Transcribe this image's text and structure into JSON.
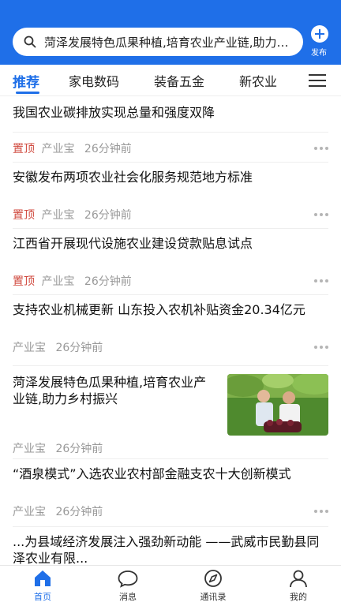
{
  "header": {
    "search_text": "菏泽发展特色瓜果种植,培育农业产业链,助力乡村振兴",
    "publish_label": "发布"
  },
  "tabs": [
    {
      "label": "推荐",
      "active": true
    },
    {
      "label": "家电数码",
      "active": false
    },
    {
      "label": "装备五金",
      "active": false
    },
    {
      "label": "新农业",
      "active": false
    }
  ],
  "feed": [
    {
      "title": "我国农业碳排放实现总量和强度双降",
      "pinned": false,
      "source": "",
      "time": ""
    },
    {
      "title": "安徽发布两项农业社会化服务规范地方标准",
      "pinned": true,
      "pin_label": "置顶",
      "source": "产业宝",
      "time": "26分钟前"
    },
    {
      "title": "江西省开展现代设施农业建设贷款贴息试点",
      "pinned": true,
      "pin_label": "置顶",
      "source": "产业宝",
      "time": "26分钟前"
    },
    {
      "title": "支持农业机械更新 山东投入农机补贴资金20.34亿元",
      "pinned": false,
      "source": "产业宝",
      "time": "26分钟前"
    },
    {
      "title": "菏泽发展特色瓜果种植,培育农业产业链,助力乡村振兴",
      "pinned": false,
      "source": "产业宝",
      "time": "26分钟前"
    },
    {
      "title": "“酒泉模式”入选农业农村部金融支农十大创新模式",
      "pinned": false,
      "source": "产业宝",
      "time": "26分钟前"
    },
    {
      "title": "...为县域经济发展注入强劲新动能 ——武威市民勤县同泽农业有限...",
      "pinned": false,
      "source": "",
      "time": ""
    }
  ],
  "top_meta": {
    "pin_label": "置顶",
    "source": "产业宝",
    "time": "26分钟前"
  },
  "bottom_nav": [
    {
      "label": "首页",
      "icon": "home-icon",
      "active": true
    },
    {
      "label": "消息",
      "icon": "message-icon",
      "active": false
    },
    {
      "label": "通讯录",
      "icon": "compass-icon",
      "active": false
    },
    {
      "label": "我的",
      "icon": "user-icon",
      "active": false
    }
  ],
  "colors": {
    "accent": "#1f6fe8",
    "pin": "#d04a3f",
    "meta": "#999999"
  }
}
